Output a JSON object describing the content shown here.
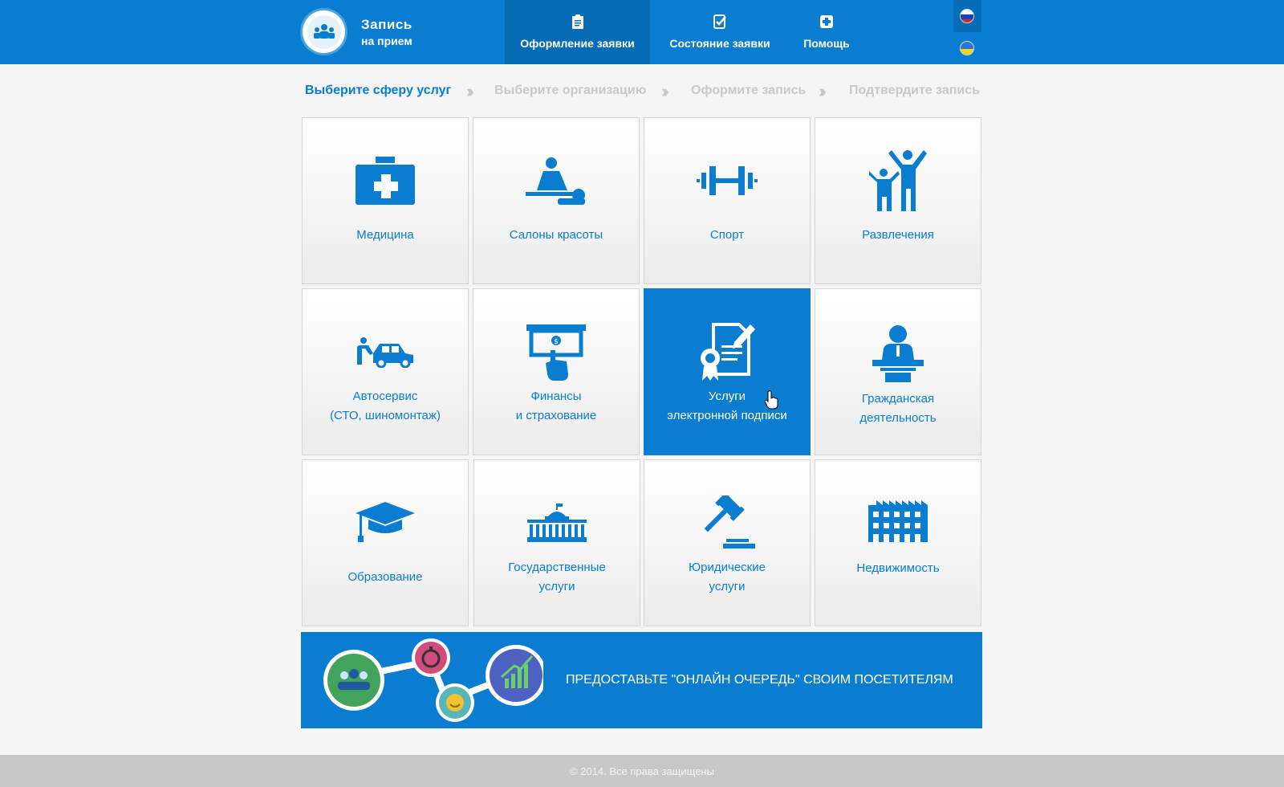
{
  "header": {
    "logo_title": "Запись",
    "logo_subtitle": "на прием",
    "nav": [
      {
        "label": "Оформление заявки",
        "icon": "clipboard-icon",
        "active": true
      },
      {
        "label": "Состояние заявки",
        "icon": "checklist-icon",
        "active": false
      },
      {
        "label": "Помощь",
        "icon": "medical-cross-icon",
        "active": false
      }
    ],
    "languages": [
      "ru-flag-icon",
      "ua-flag-icon"
    ]
  },
  "steps": [
    {
      "label": "Выберите сферу услуг",
      "active": true
    },
    {
      "label": "Выберите организацию",
      "active": false
    },
    {
      "label": "Оформите запись",
      "active": false
    },
    {
      "label": "Подтвердите запись",
      "active": false
    }
  ],
  "tiles": [
    {
      "label": "Медицина",
      "icon": "first-aid-kit-icon"
    },
    {
      "label": "Салоны красоты",
      "icon": "massage-icon"
    },
    {
      "label": "Спорт",
      "icon": "dumbbell-icon"
    },
    {
      "label": "Развлечения",
      "icon": "family-cheer-icon"
    },
    {
      "label": "Автосервис\n(СТО, шиномонтаж)",
      "icon": "car-service-icon"
    },
    {
      "label": "Финансы\nи страхование",
      "icon": "atm-hand-icon"
    },
    {
      "label": "Услуги\nэлектронной подписи",
      "icon": "certificate-sign-icon",
      "selected": true
    },
    {
      "label": "Гражданская\nдеятельность",
      "icon": "speaker-podium-icon"
    },
    {
      "label": "Образование",
      "icon": "graduation-cap-icon"
    },
    {
      "label": "Государственные\nуслуги",
      "icon": "government-building-icon"
    },
    {
      "label": "Юридические\nуслуги",
      "icon": "gavel-icon"
    },
    {
      "label": "Недвижимость",
      "icon": "building-icon"
    }
  ],
  "banner": {
    "text": "ПРЕДОСТАВЬТЕ \"ОНЛАЙН ОЧЕРЕДЬ\" СВОИМ ПОСЕТИТЕЛЯМ"
  },
  "footer": {
    "text": "© 2014. Все права защищены"
  },
  "colors": {
    "primary": "#0a7dd0",
    "primary_dark": "#066cb5",
    "inactive_step": "#c9c9c9",
    "footer_bg": "#c8c8c8"
  }
}
